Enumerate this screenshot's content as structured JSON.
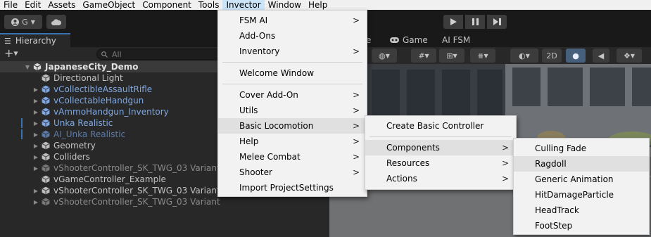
{
  "menubar": {
    "items": [
      "File",
      "Edit",
      "Assets",
      "GameObject",
      "Component",
      "Tools",
      "Invector",
      "Window",
      "Help"
    ],
    "active_index": 6
  },
  "toolbar": {
    "account_label": "G",
    "play_icon": "play-icon",
    "pause_icon": "pause-icon",
    "step_icon": "step-icon"
  },
  "hierarchy": {
    "tab_label": "Hierarchy",
    "add_label": "+",
    "search_placeholder": "All",
    "scene_name": "JapaneseCity_Demo",
    "objects": [
      {
        "name": "Directional Light",
        "style": "normal",
        "expandable": false
      },
      {
        "name": "vCollectibleAssaultRifle",
        "style": "prefab",
        "expandable": true
      },
      {
        "name": "vCollectableHandgun",
        "style": "prefab",
        "expandable": true
      },
      {
        "name": "vAmmoHandgun_Inventory",
        "style": "prefab",
        "expandable": true
      },
      {
        "name": "Unka Realistic",
        "style": "prefab",
        "expandable": true
      },
      {
        "name": "AI_Unka Realistic",
        "style": "prefab-dim",
        "expandable": true
      },
      {
        "name": "Geometry",
        "style": "normal",
        "expandable": true
      },
      {
        "name": "Colliders",
        "style": "normal",
        "expandable": true
      },
      {
        "name": "vShooterController_SK_TWG_03 Variant",
        "style": "dim",
        "expandable": true
      },
      {
        "name": "vGameController_Example",
        "style": "normal",
        "expandable": false
      },
      {
        "name": "vShooterController_SK_TWG_03 Variant",
        "style": "normal",
        "expandable": true
      },
      {
        "name": "vShooterController_SK_TWG_03 Variant",
        "style": "dim",
        "expandable": true
      }
    ]
  },
  "scene": {
    "tabs": [
      "e",
      "Game",
      "AI FSM"
    ],
    "mode_2d_label": "2D"
  },
  "menus": {
    "invector": [
      {
        "label": "FSM AI",
        "submenu": true
      },
      {
        "label": "Add-Ons",
        "submenu": false
      },
      {
        "label": "Inventory",
        "submenu": true
      },
      {
        "separator": true
      },
      {
        "label": "Welcome Window",
        "submenu": false
      },
      {
        "separator": true
      },
      {
        "label": "Cover Add-On",
        "submenu": true
      },
      {
        "label": "Utils",
        "submenu": true
      },
      {
        "label": "Basic Locomotion",
        "submenu": true,
        "highlighted": true
      },
      {
        "label": "Help",
        "submenu": true
      },
      {
        "label": "Melee Combat",
        "submenu": true
      },
      {
        "label": "Shooter",
        "submenu": true
      },
      {
        "label": "Import ProjectSettings",
        "submenu": false
      }
    ],
    "basic_locomotion": [
      {
        "label": "Create Basic Controller",
        "submenu": false
      },
      {
        "separator": true
      },
      {
        "label": "Components",
        "submenu": true,
        "highlighted": true
      },
      {
        "label": "Resources",
        "submenu": true
      },
      {
        "label": "Actions",
        "submenu": true
      }
    ],
    "components": [
      {
        "label": "Culling Fade",
        "submenu": false
      },
      {
        "label": "Ragdoll",
        "submenu": false,
        "highlighted": true
      },
      {
        "label": "Generic Animation",
        "submenu": false
      },
      {
        "label": "HitDamageParticle",
        "submenu": false
      },
      {
        "label": "HeadTrack",
        "submenu": false
      },
      {
        "label": "FootStep",
        "submenu": false
      }
    ]
  },
  "colors": {
    "menubar_bg": "#f0f0f0",
    "editor_dark": "#191919",
    "panel": "#282828",
    "prefab_blue": "#7fa8e3",
    "menu_bg": "#f2f2f2",
    "menu_highlight": "#e0e0e0",
    "selection_marker": "#3a72b0"
  }
}
